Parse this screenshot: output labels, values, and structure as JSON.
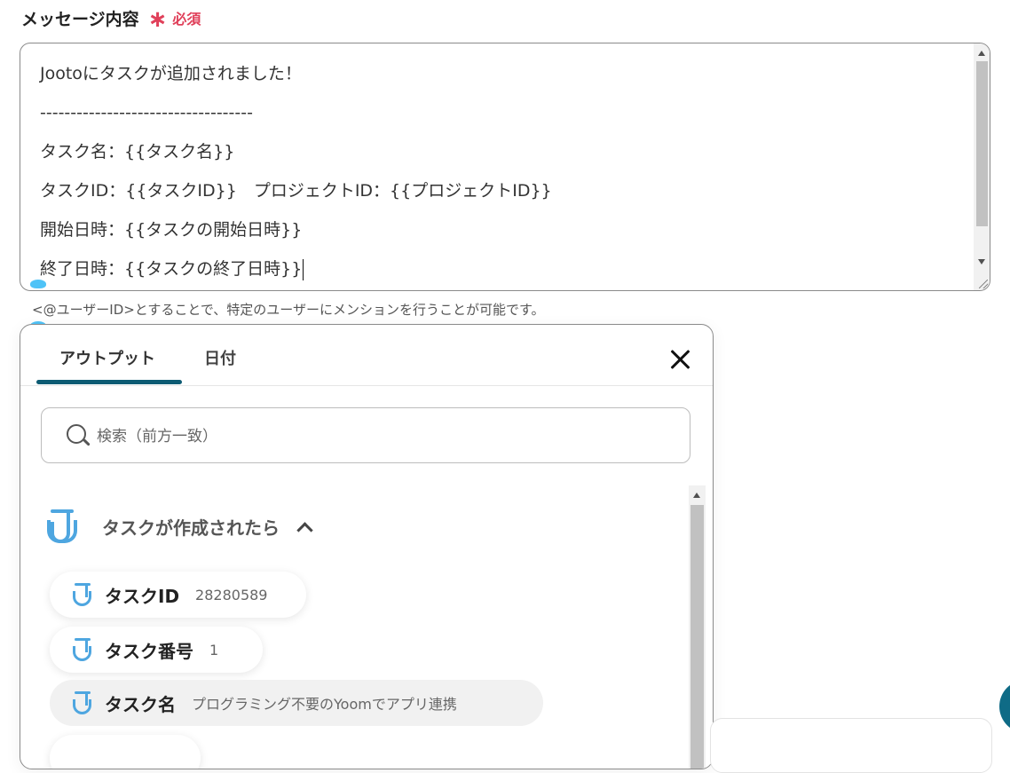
{
  "field": {
    "label": "メッセージ内容",
    "required_mark": "∗",
    "required_label": "必須"
  },
  "message": {
    "lines": [
      "Jootoにタスクが追加されました！",
      "-----------------------------------",
      "タスク名：{{タスク名}}",
      "タスクID：{{タスクID}}　プロジェクトID：{{プロジェクトID}}",
      "開始日時：{{タスクの開始日時}}",
      "終了日時：{{タスクの終了日時}}"
    ]
  },
  "hint": "<@ユーザーID>とすることで、特定のユーザーにメンションを行うことが可能です。",
  "panel": {
    "tabs": [
      "アウトプット",
      "日付"
    ],
    "active_tab": "アウトプット",
    "search_placeholder": "検索（前方一致）",
    "group": {
      "title": "タスクが作成されたら",
      "icon": "jooto-logo-icon",
      "expanded": true
    },
    "items": [
      {
        "label": "タスクID",
        "value": "28280589"
      },
      {
        "label": "タスク番号",
        "value": "1"
      },
      {
        "label": "タスク名",
        "value": "プログラミング不要のYoomでアプリ連携"
      }
    ]
  },
  "colors": {
    "required": "#e0405a",
    "tab_underline": "#0d5b73",
    "jooto_icon": "#4ea6e0",
    "handle": "#4fc3f7",
    "fab": "#0f6b86"
  }
}
